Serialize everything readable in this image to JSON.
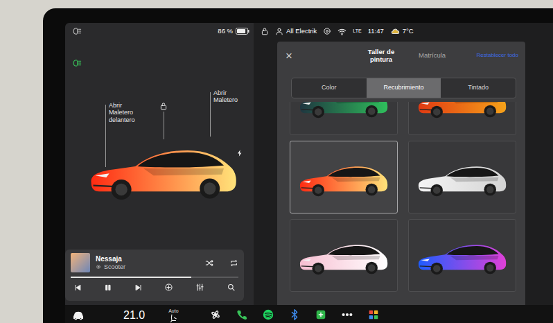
{
  "status_bar": {
    "battery": "86 %",
    "battery_level": 0.86,
    "user": "All Electrik",
    "signal": "LTE",
    "time": "11:47",
    "temperature": "7°C"
  },
  "car_view": {
    "labels": [
      "Abrir Maletero delantero",
      "Abrir Maletero"
    ]
  },
  "media": {
    "title": "Nessaja",
    "artist": "Scooter",
    "level": 0.72,
    "playing": true
  },
  "paint_shop": {
    "close": "×",
    "sections": [
      {
        "label": "Taller de pintura",
        "selected": true
      },
      {
        "label": "Matrícula",
        "selected": false
      }
    ],
    "reset": "Restablecer todo",
    "tabs": [
      {
        "label": "Color",
        "selected": false
      },
      {
        "label": "Recubrimiento",
        "selected": true
      },
      {
        "label": "Tintado",
        "selected": false
      }
    ],
    "wraps": [
      {
        "selected": false,
        "color": "#1f3640",
        "color_end": "#2fbf5c"
      },
      {
        "selected": false,
        "color": "#e03a12",
        "color_end": "#f6a21a"
      },
      {
        "selected": true,
        "color": "#ff2b12",
        "color_end": "#ffe37a"
      },
      {
        "selected": false,
        "color": "#f4f4f4",
        "color_end": "#d4d4d4"
      },
      {
        "selected": false,
        "color": "#f7bfd2",
        "color_end": "#ffffff"
      },
      {
        "selected": false,
        "color": "#1e5cff",
        "color_end": "#e040d8"
      }
    ]
  },
  "climate": {
    "temperature": "21.0",
    "seat_mode": "Auto"
  }
}
